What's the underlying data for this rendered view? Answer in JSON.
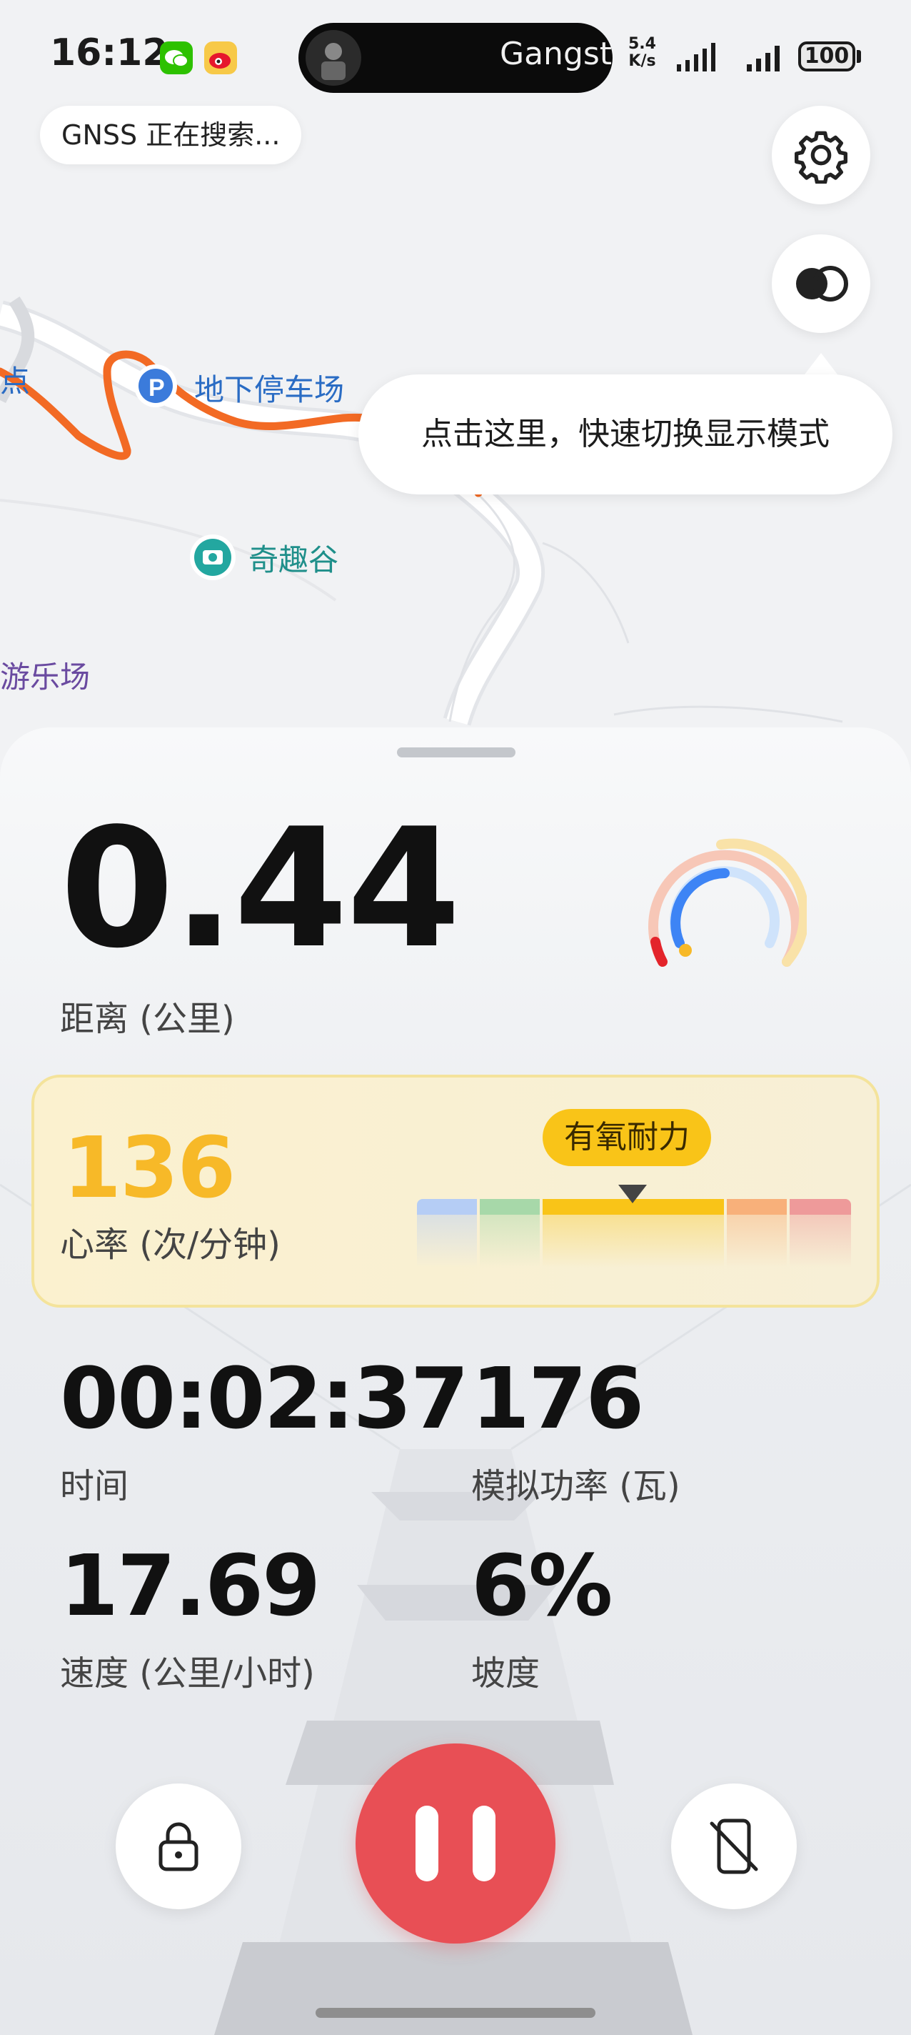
{
  "status_bar": {
    "time": "16:12",
    "now_playing": "Gangst",
    "net_speed_value": "5.4",
    "net_speed_unit": "K/s",
    "battery": "100"
  },
  "map": {
    "gnss_status": "GNSS 正在搜索...",
    "poi_parking": "地下停车场",
    "poi_attraction": "奇趣谷",
    "poi_park": "游乐场",
    "poi_partial": "点",
    "tooltip": "点击这里，快速切换显示模式",
    "track_color": "#f26a24"
  },
  "workout": {
    "distance_value": "0.44",
    "distance_label": "距离 (公里)",
    "heart_rate_value": "136",
    "heart_rate_label": "心率 (次/分钟)",
    "heart_rate_zone": "有氧耐力",
    "zone_colors": [
      "#b5cdf5",
      "#a7d8a9",
      "#f9c418",
      "#f8b07a",
      "#ee9a9a"
    ],
    "time_value": "00:02:37",
    "time_label": "时间",
    "power_value": "176",
    "power_label": "模拟功率 (瓦)",
    "speed_value": "17.69",
    "speed_label": "速度 (公里/小时)",
    "grade_value": "6%",
    "grade_label": "坡度"
  },
  "colors": {
    "pause_button": "#e84f55",
    "heart_rate_value": "#f7b928"
  }
}
